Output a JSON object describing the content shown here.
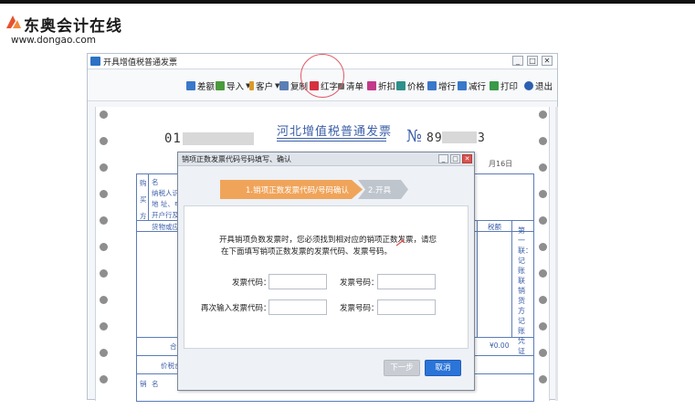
{
  "brand": {
    "name": "东奥会计在线",
    "url": "www.dongao.com"
  },
  "window": {
    "title": "开具增值税普通发票",
    "minimize": "_",
    "maximize": "□",
    "close": "✕"
  },
  "toolbar": {
    "items": [
      {
        "label": "差额",
        "icon": "diff-icon",
        "color": "#3a78c9"
      },
      {
        "label": "导入",
        "icon": "import-icon",
        "color": "#4b9a3c",
        "dropdown": true
      },
      {
        "label": "客户",
        "icon": "customer-icon",
        "color": "#d99a2b",
        "dropdown": true
      },
      {
        "label": "复制",
        "icon": "copy-icon",
        "color": "#5b7fb5"
      },
      {
        "label": "红字",
        "icon": "red-invoice-icon",
        "color": "#d6313f"
      },
      {
        "label": "清单",
        "icon": "list-icon",
        "color": "#6a6a6a"
      },
      {
        "label": "折扣",
        "icon": "discount-icon",
        "color": "#c23a8a"
      },
      {
        "label": "价格",
        "icon": "price-icon",
        "color": "#2f8f8a"
      },
      {
        "label": "增行",
        "icon": "add-row-icon",
        "color": "#3a78c9"
      },
      {
        "label": "减行",
        "icon": "remove-row-icon",
        "color": "#3a78c9"
      },
      {
        "label": "打印",
        "icon": "print-icon",
        "color": "#3a9a4a"
      },
      {
        "label": "退出",
        "icon": "exit-icon",
        "color": "#2d5fb0"
      }
    ]
  },
  "invoice": {
    "title": "河北增值税普通发票",
    "code_prefix": "01",
    "no_symbol": "№",
    "no_prefix": "89",
    "no_suffix": "3",
    "date_tail": "月16日",
    "buyer_labels": [
      "购",
      "买",
      "方"
    ],
    "buyer_fields": [
      "名",
      "纳税人识",
      "地 址、电",
      "开户行及"
    ],
    "goods_header": "货物或应税",
    "amount_header": "税额",
    "total_label": "合",
    "total_amount": "¥0.00",
    "price_tax_label": "价税合",
    "seller_label": "销",
    "seller_field": "名",
    "side_note": "第一联：记账联 销货方记账凭证"
  },
  "dialog": {
    "title": "销项正数发票代码号码填写、确认",
    "steps": [
      {
        "label": "1.销项正数发票代码/号码确认",
        "active": true
      },
      {
        "label": "2.开具",
        "active": false
      }
    ],
    "instruction_line1": "开具销项负数发票时，您必须找到相对应的销项正数发票，请您",
    "instruction_line2": "在下面填写销项正数发票的发票代码、发票号码。",
    "fields": {
      "code_label": "发票代码：",
      "code_value": "",
      "number_label": "发票号码：",
      "number_value": "",
      "code_confirm_label": "再次输入发票代码：",
      "code_confirm_value": "",
      "number_confirm_label": "发票号码：",
      "number_confirm_value": ""
    },
    "buttons": {
      "prev": "下一步",
      "cancel": "取消"
    }
  }
}
